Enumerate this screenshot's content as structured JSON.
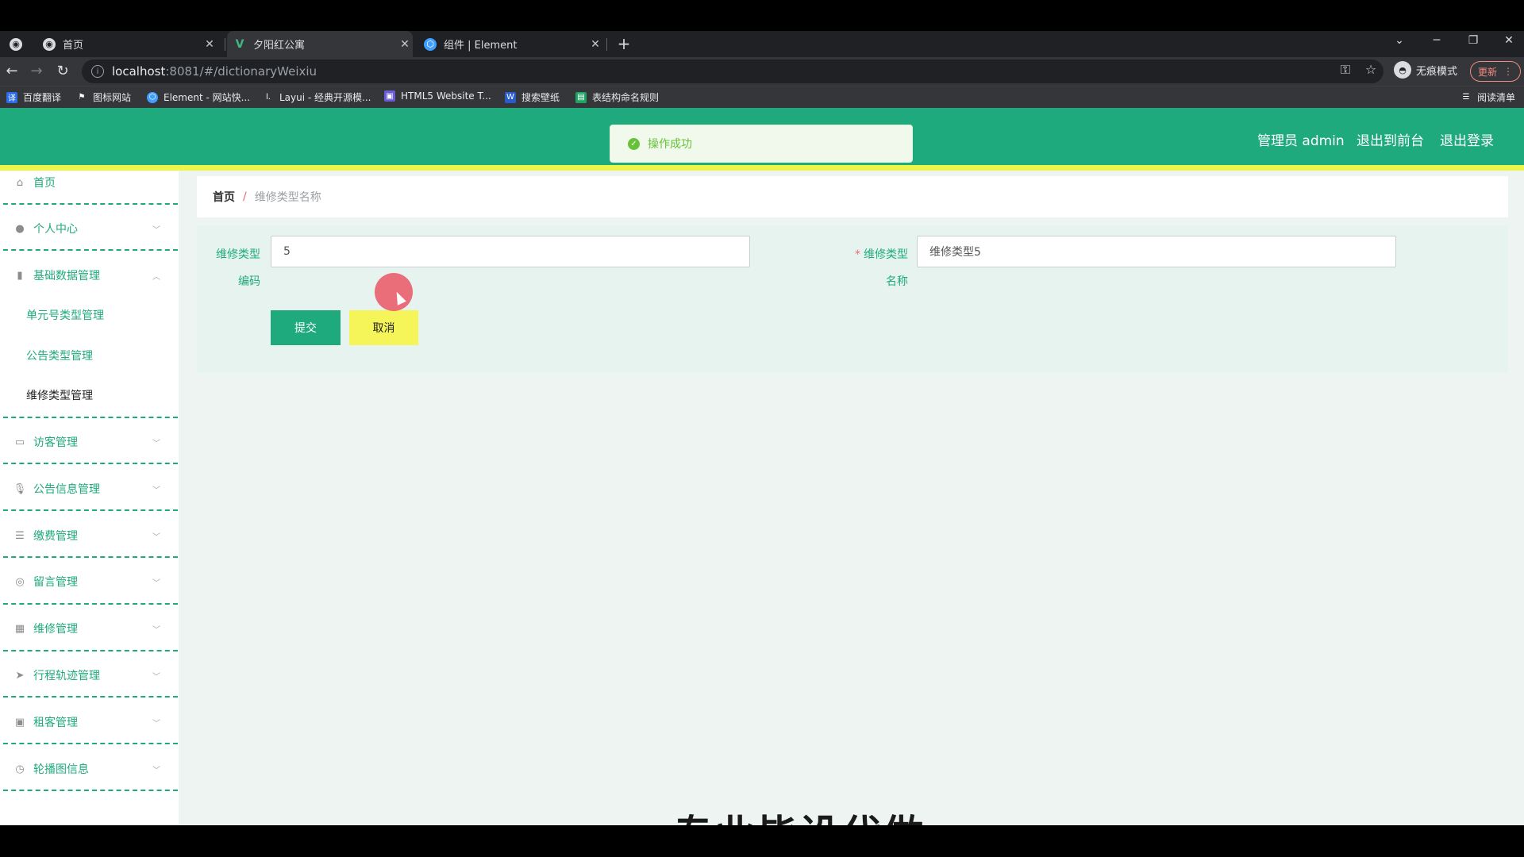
{
  "browser": {
    "tabs": [
      {
        "label": "首页",
        "icon": "globe-icon"
      },
      {
        "label": "夕阳红公寓",
        "icon": "vue-icon"
      },
      {
        "label": "组件 | Element",
        "icon": "element-icon"
      }
    ],
    "url_host": "localhost",
    "url_rest": ":8081/#/dictionaryWeixiu",
    "incognito_label": "无痕模式",
    "update_label": "更新",
    "bookmarks": [
      "百度翻译",
      "图标网站",
      "Element - 网站快...",
      "Layui - 经典开源模...",
      "HTML5 Website T...",
      "搜索壁纸",
      "表结构命名规则"
    ],
    "reading_list": "阅读清单"
  },
  "header": {
    "admin": "管理员 admin",
    "back_front": "退出到前台",
    "logout": "退出登录",
    "toast": "操作成功",
    "colors": {
      "primary": "#1faa7e",
      "accent": "#eef549"
    }
  },
  "sidebar": {
    "items": [
      {
        "label": "首页",
        "icon": "home-icon"
      },
      {
        "label": "个人中心",
        "icon": "user-icon"
      },
      {
        "label": "基础数据管理",
        "icon": "chart-icon"
      },
      {
        "label": "访客管理",
        "icon": "monitor-icon"
      },
      {
        "label": "公告信息管理",
        "icon": "microphone-icon"
      },
      {
        "label": "缴费管理",
        "icon": "sliders-icon"
      },
      {
        "label": "留言管理",
        "icon": "basketball-icon"
      },
      {
        "label": "维修管理",
        "icon": "grid-icon"
      },
      {
        "label": "行程轨迹管理",
        "icon": "send-icon"
      },
      {
        "label": "租客管理",
        "icon": "clipboard-icon"
      },
      {
        "label": "轮播图信息",
        "icon": "clock-icon"
      }
    ],
    "subitems": [
      "单元号类型管理",
      "公告类型管理",
      "维修类型管理"
    ]
  },
  "breadcrumb": {
    "home": "首页",
    "sep": "/",
    "current": "维修类型名称"
  },
  "form": {
    "code_label_1": "维修类型",
    "code_label_2": "编码",
    "code_value": "5",
    "name_label_1": "维修类型",
    "name_label_2": "名称",
    "name_value": "维修类型5",
    "required_mark": "*",
    "submit": "提交",
    "cancel": "取消"
  },
  "watermark": "专业毕设代做"
}
